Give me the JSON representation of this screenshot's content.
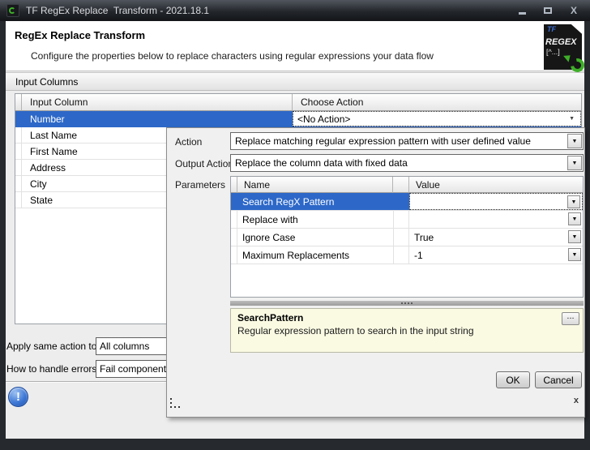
{
  "icons": {
    "close": "X",
    "dropdown_arrow": "▼",
    "flat_arrow": "▼",
    "resize_x": "x",
    "help": "!"
  },
  "window": {
    "title": "TF RegEx Replace  Transform - 2021.18.1"
  },
  "header": {
    "title": "RegEx Replace Transform",
    "subtitle": "Configure the properties below to replace characters using regular expressions your data flow",
    "badge_tf": "TF",
    "badge_regex": "REGEX",
    "badge_pattern": "[^...]"
  },
  "input_columns": {
    "group_label": "Input Columns",
    "col1_header": "Input Column",
    "col2_header": "Choose Action",
    "selected_row": {
      "name": "Number",
      "action": "<No Action>"
    },
    "rows": [
      "Last Name",
      "First Name",
      "Address",
      "City",
      "State"
    ]
  },
  "editor": {
    "action_label": "Action",
    "action_value": "Replace matching regular expression pattern with user defined value",
    "output_action_label": "Output Action",
    "output_action_value": "Replace the column data with fixed data",
    "parameters_label": "Parameters",
    "param_table": {
      "name_header": "Name",
      "value_header": "Value",
      "rows": [
        {
          "name": "Search RegX Pattern",
          "value": ""
        },
        {
          "name": "Replace with",
          "value": ""
        },
        {
          "name": "Ignore Case",
          "value": "True"
        },
        {
          "name": "Maximum Replacements",
          "value": "-1"
        }
      ]
    },
    "description": {
      "title": "SearchPattern",
      "text": "Regular expression pattern to search in the input string",
      "ellipsis": "..."
    },
    "ok_label": "OK",
    "cancel_label": "Cancel"
  },
  "footer": {
    "apply_label": "Apply same action to",
    "apply_value": "All columns",
    "errors_label": "How to handle errors",
    "errors_value": "Fail component"
  }
}
